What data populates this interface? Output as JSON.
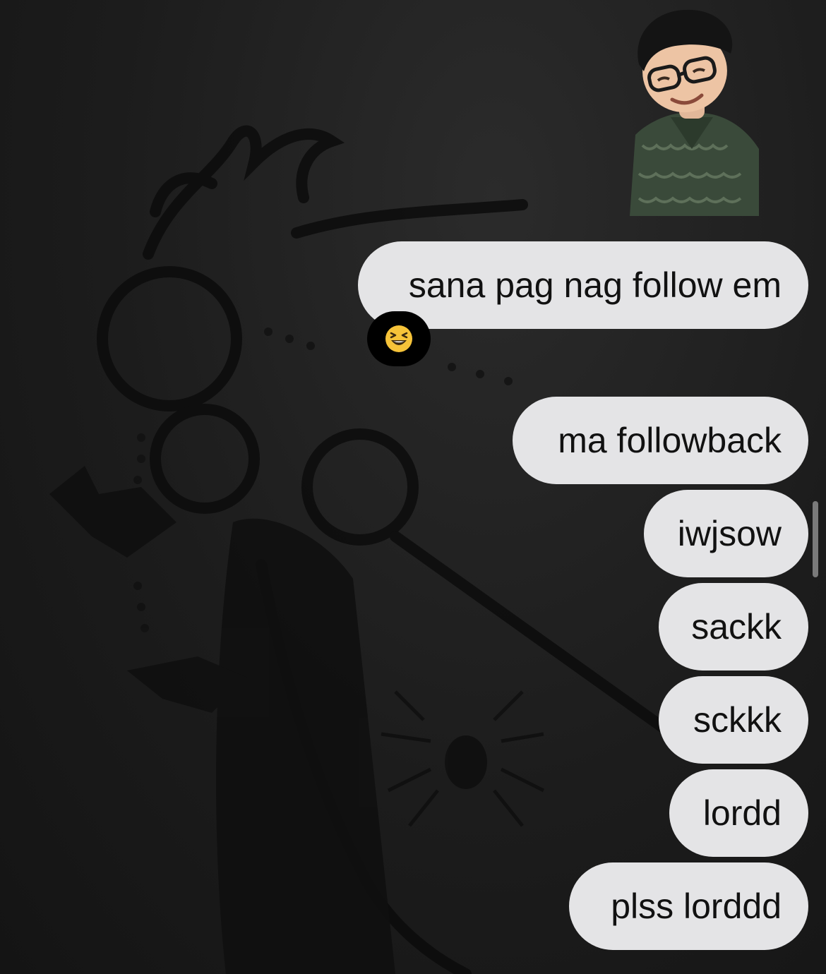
{
  "messages": [
    {
      "text": "sana pag nag follow em",
      "reaction": "laughing-squinting-face"
    },
    {
      "text": "ma followback"
    },
    {
      "text": "iwjsow"
    },
    {
      "text": "sackk"
    },
    {
      "text": "sckkk"
    },
    {
      "text": "lordd"
    },
    {
      "text": "plss lorddd"
    }
  ],
  "colors": {
    "bubble": "#e4e4e6",
    "bubble_text": "#111111",
    "background": "#1a1a1a",
    "reaction_bg": "#000000"
  },
  "icons": {
    "avatar": "memoji-avatar",
    "reaction": "laughing-face-emoji"
  }
}
